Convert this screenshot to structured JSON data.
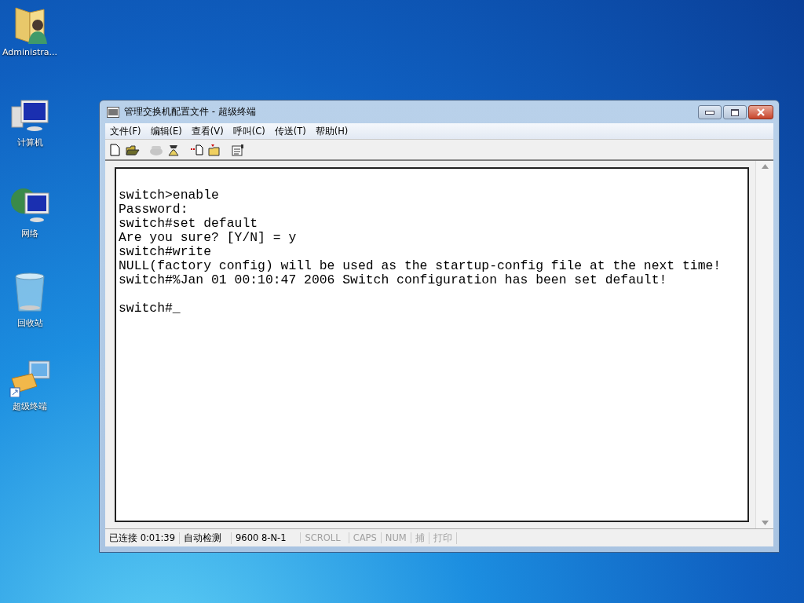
{
  "desktop_icons": [
    {
      "kind": "user-folder",
      "label": "Administra..."
    },
    {
      "kind": "computer",
      "label": "计算机"
    },
    {
      "kind": "network",
      "label": "网络"
    },
    {
      "kind": "recycle-bin",
      "label": "回收站"
    },
    {
      "kind": "terminal",
      "label": "超级终端"
    }
  ],
  "window": {
    "title": "管理交换机配置文件 - 超级终端",
    "menu": [
      "文件(F)",
      "编辑(E)",
      "查看(V)",
      "呼叫(C)",
      "传送(T)",
      "帮助(H)"
    ],
    "toolbar": [
      {
        "kind": "new",
        "disabled": false
      },
      {
        "kind": "open",
        "disabled": false
      },
      {
        "kind": "call",
        "disabled": true
      },
      {
        "kind": "hangup",
        "disabled": false
      },
      {
        "kind": "send",
        "disabled": false
      },
      {
        "kind": "receive",
        "disabled": false
      },
      {
        "kind": "properties",
        "disabled": false
      }
    ],
    "terminal_blocks": [
      [
        "switch>enable",
        "Password:",
        "switch#set default",
        "Are you sure? [Y/N] = y",
        "switch#write",
        "NULL(factory config) will be used as the startup-config file at the next time!",
        "switch#%Jan 01 00:10:47 2006 Switch configuration has been set default!"
      ],
      [
        "switch#_"
      ]
    ],
    "status_bar": [
      {
        "text": "已连接 0:01:39",
        "disabled": false
      },
      {
        "text": "自动检测",
        "disabled": false
      },
      {
        "text": "9600 8-N-1",
        "disabled": false
      },
      {
        "text": "SCROLL",
        "disabled": true
      },
      {
        "text": "CAPS",
        "disabled": true
      },
      {
        "text": "NUM",
        "disabled": true
      },
      {
        "text": "捕",
        "disabled": true
      },
      {
        "text": "打印",
        "disabled": true
      }
    ]
  }
}
